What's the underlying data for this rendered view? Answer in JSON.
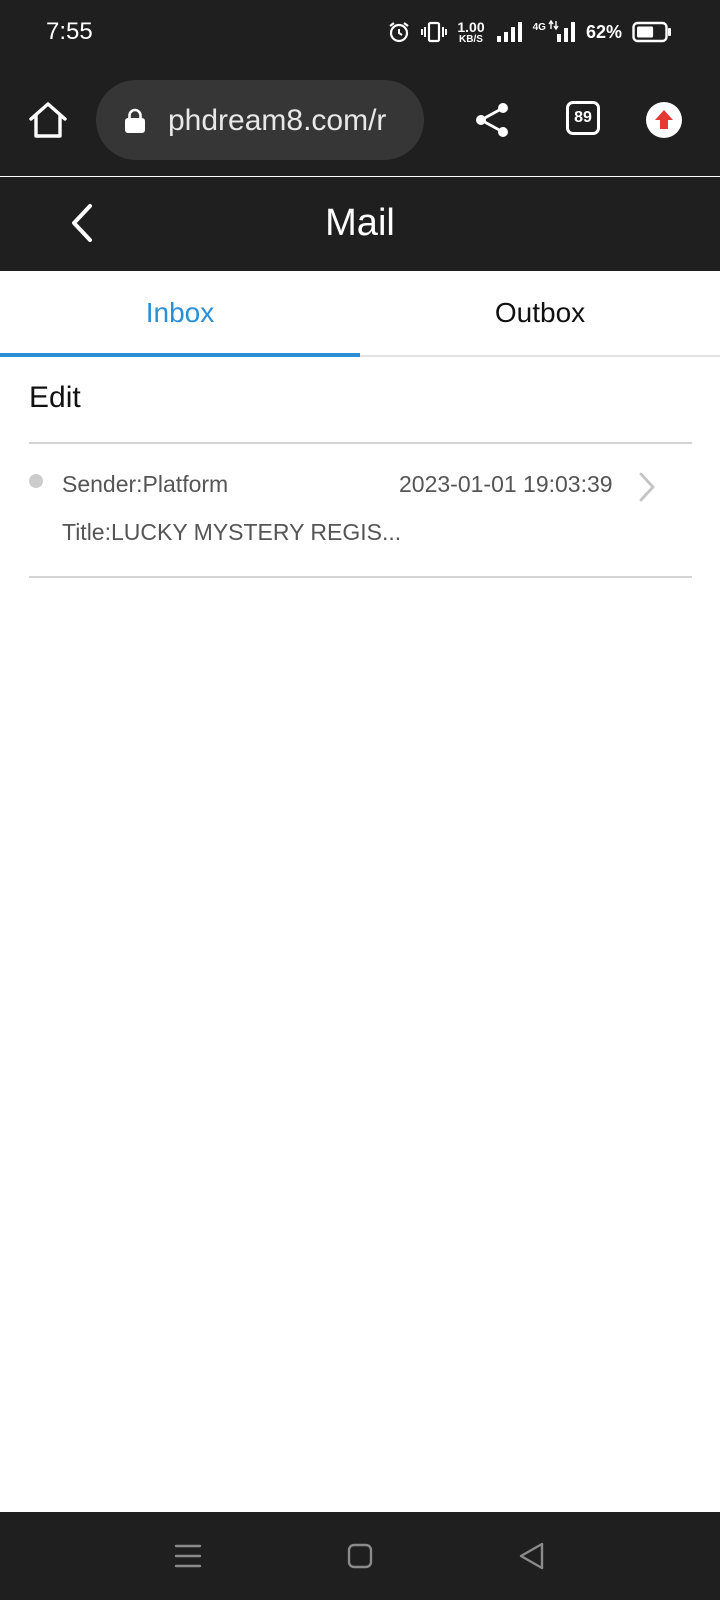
{
  "status_bar": {
    "time": "7:55",
    "speed_value": "1.00",
    "speed_unit": "KB/S",
    "network_label": "4G",
    "battery_percent": "62%",
    "battery_level": 0.62
  },
  "browser": {
    "url": "phdream8.com/r",
    "tab_count": "89",
    "update_badge_color": "#e53935"
  },
  "header": {
    "title": "Mail"
  },
  "tabs": [
    {
      "label": "Inbox",
      "active": true
    },
    {
      "label": "Outbox",
      "active": false
    }
  ],
  "toolbar": {
    "edit_label": "Edit"
  },
  "mail_list": [
    {
      "sender": "Sender:Platform",
      "date": "2023-01-01 19:03:39",
      "title": "Title:LUCKY MYSTERY REGIS..."
    }
  ],
  "colors": {
    "accent": "#2b8fd6",
    "bar_background": "#1f1f1f"
  }
}
